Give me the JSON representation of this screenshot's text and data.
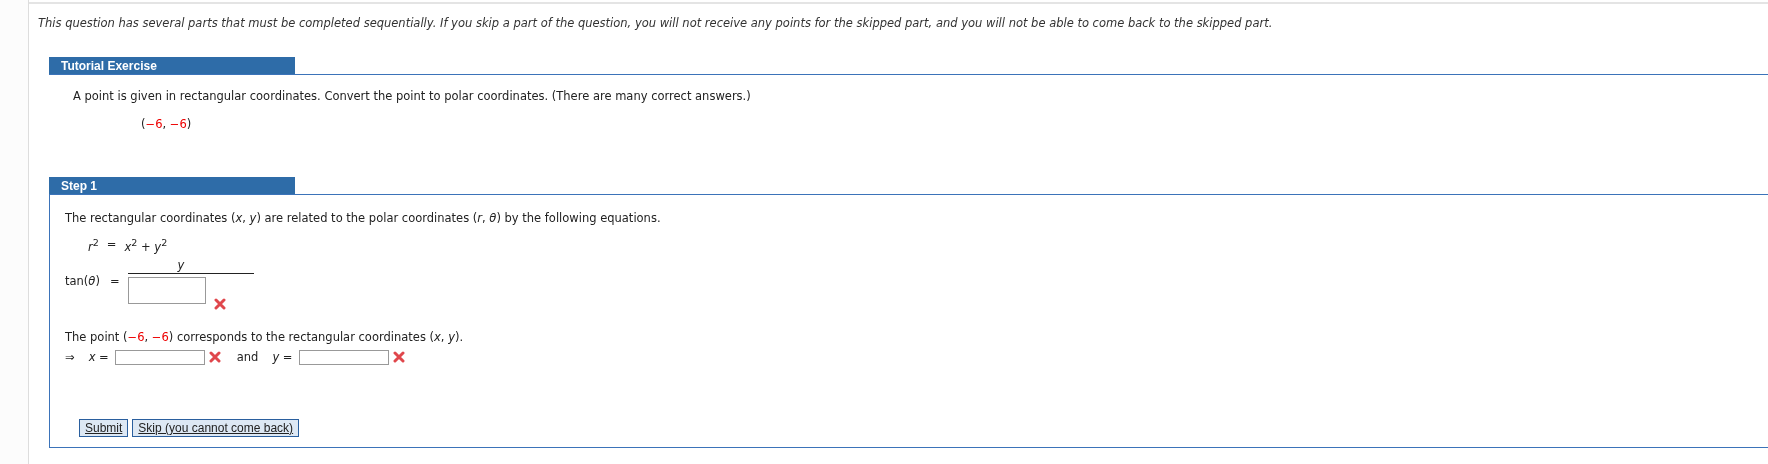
{
  "notice": "This question has several parts that must be completed sequentially. If you skip a part of the question, you will not receive any points for the skipped part, and you will not be able to come back to the skipped part.",
  "tutorial": {
    "title": "Tutorial Exercise",
    "prompt": "A point is given in rectangular coordinates. Convert the point to polar coordinates. (There are many correct answers.)",
    "point": [
      {
        "kind": "text",
        "text": "("
      },
      {
        "kind": "value",
        "text": "−6"
      },
      {
        "kind": "text",
        "text": ", "
      },
      {
        "kind": "value",
        "text": "−6"
      },
      {
        "kind": "text",
        "text": ")"
      }
    ]
  },
  "step": {
    "title": "Step 1",
    "intro": "The rectangular coordinates (*x*, *y*) are related to the polar coordinates (*r*, *θ*) by the following equations.",
    "equation": {
      "left": "*r*$^{2}$",
      "operator": "=",
      "right": "*x*$^{2}$ + *y*$^{2}$"
    },
    "tan_equation": {
      "left": "tan(*θ*)",
      "operator": "=",
      "numerator": "*y*",
      "denominator_field": {
        "correct": false
      }
    },
    "sentence": [
      {
        "kind": "text",
        "text": "The point "
      },
      {
        "kind": "text",
        "text": "("
      },
      {
        "kind": "value",
        "text": "−6"
      },
      {
        "kind": "text",
        "text": ", "
      },
      {
        "kind": "value",
        "text": "−6"
      },
      {
        "kind": "text",
        "text": ") corresponds to the rectangular coordinates (*x*, *y*)."
      }
    ],
    "answer_row": {
      "arrow": "⇒",
      "x_label": "*x* =",
      "x_field": {
        "correct": false
      },
      "joiner": "and",
      "y_label": "*y* =",
      "y_field": {
        "correct": false
      }
    },
    "buttons": [
      "Submit",
      "Skip (you cannot come back)"
    ]
  }
}
